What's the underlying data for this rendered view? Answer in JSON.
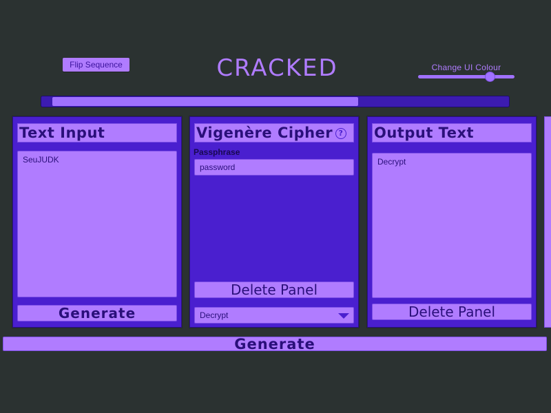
{
  "header": {
    "flip_label": "Flip Sequence",
    "title": "CRACKED",
    "colour_label": "Change UI Colour",
    "colour_slider_value": 0.74
  },
  "progress": {
    "fill_fraction": 0.67
  },
  "panels": {
    "input": {
      "title": "Text Input",
      "text": "SeuJUDK",
      "generate_label": "Generate"
    },
    "cipher": {
      "title": "Vigenère Cipher",
      "help_icon": "?",
      "passphrase_label": "Passphrase",
      "passphrase_value": "password",
      "delete_label": "Delete Panel",
      "mode_value": "Decrypt"
    },
    "output": {
      "title": "Output Text",
      "text": "Decrypt",
      "delete_label": "Delete Panel"
    }
  },
  "footer": {
    "generate_label": "Generate"
  },
  "colors": {
    "background": "#2b3231",
    "panel": "#4a1fcf",
    "accent": "#b07cff",
    "text_dark": "#2a0f7a"
  }
}
